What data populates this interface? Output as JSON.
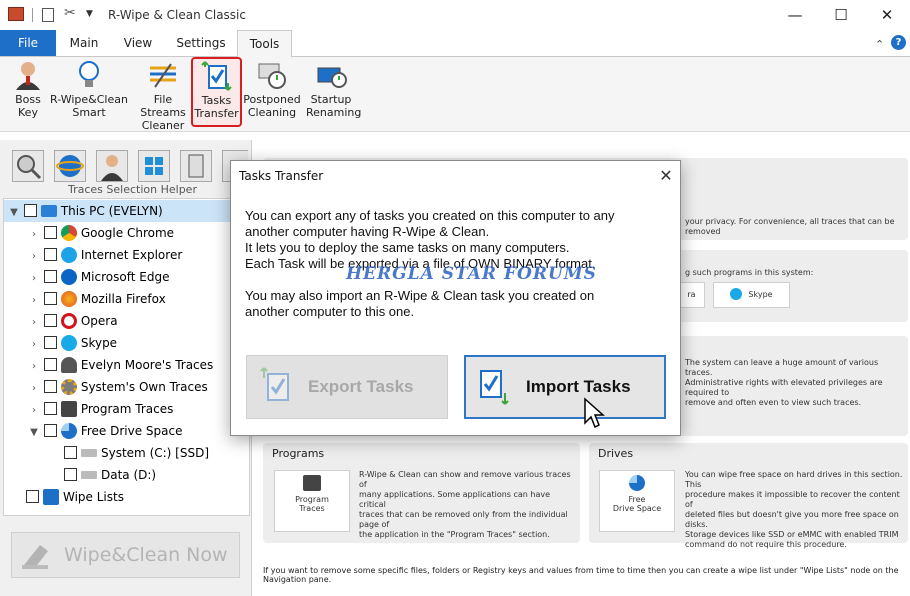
{
  "window": {
    "title": "R-Wipe & Clean Classic",
    "minimize": "—",
    "maximize": "☐",
    "close": "✕"
  },
  "ribbon_tabs": [
    "File",
    "Main",
    "View",
    "Settings",
    "Tools"
  ],
  "ribbon_buttons": [
    {
      "line1": "Boss",
      "line2": "Key"
    },
    {
      "line1": "R-Wipe&Clean",
      "line2": "Smart"
    },
    {
      "line1": "File Streams",
      "line2": "Cleaner"
    },
    {
      "line1": "Tasks",
      "line2": "Transfer"
    },
    {
      "line1": "Postponed",
      "line2": "Cleaning"
    },
    {
      "line1": "Startup",
      "line2": "Renaming"
    }
  ],
  "helper_label": "Traces Selection Helper",
  "tree": [
    {
      "label": "This PC  (EVELYN)"
    },
    {
      "label": "Google Chrome"
    },
    {
      "label": "Internet  Explorer"
    },
    {
      "label": "Microsoft Edge"
    },
    {
      "label": "Mozilla Firefox"
    },
    {
      "label": "Opera"
    },
    {
      "label": "Skype"
    },
    {
      "label": "Evelyn Moore's Traces"
    },
    {
      "label": "System's Own Traces"
    },
    {
      "label": "Program Traces"
    },
    {
      "label": "Free Drive Space"
    },
    {
      "label": "System  (C:) [SSD]"
    },
    {
      "label": "Data  (D:)"
    },
    {
      "label": "Wipe Lists"
    }
  ],
  "wipe_button": "Wipe&Clean Now",
  "right": {
    "privacy_text": "your privacy. For convenience, all traces that can be removed",
    "programs_hint": "g such programs in this system:",
    "tile_opera": "ra",
    "tile_skype": "Skype",
    "system_text": [
      "The system can leave a huge amount of various traces.",
      "Administrative rights with elevated privileges are required to",
      "remove and often even to view such traces."
    ],
    "programs_title": "Programs",
    "programs_text": [
      "R-Wipe & Clean can show and remove various traces of",
      "many applications. Some applications can have critical",
      "traces that can be removed only from the individual page of",
      "the application in the \"Program Traces\" section."
    ],
    "program_traces_tile": [
      "Program",
      "Traces"
    ],
    "drives_title": "Drives",
    "drives_text": [
      "You can wipe free space on hard drives in this section. This",
      "procedure makes it impossible to recover the content of",
      "deleted files but doesn't give you more free space on disks.",
      "Storage devices like SSD or eMMC with enabled TRIM",
      "command do not require this  procedure."
    ],
    "free_drive_tile": [
      "Free",
      "Drive Space"
    ],
    "bottom_note": "If you want to remove some specific files, folders or Registry keys and values from time to time then you can create a wipe list under \"Wipe Lists\" node on the Navigation pane."
  },
  "dialog": {
    "title": "Tasks Transfer",
    "close": "✕",
    "lines": [
      "You can export any of tasks you created on this computer to any",
      "another computer having R-Wipe & Clean.",
      "It lets you to deploy the same tasks on many computers.",
      "Each Task will be exported via a file of OWN BINARY format.",
      "",
      "You may also import an R-Wipe & Clean task you created on",
      "another computer to this one."
    ],
    "watermark": "HERGLA STAR FORUMS",
    "export_label": "Export Tasks",
    "import_label": "Import Tasks"
  }
}
